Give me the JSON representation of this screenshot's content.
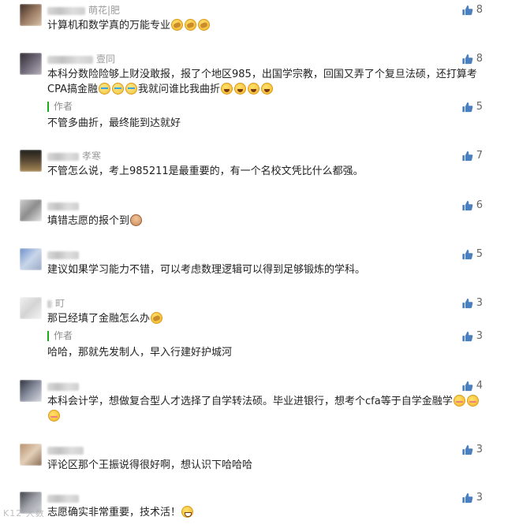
{
  "colors": {
    "accent_green": "#1aad19",
    "text": "#222222",
    "muted": "#9a9a9a"
  },
  "like_icon": "thumbs-up-icon",
  "comments": [
    {
      "name_suffix": "萌花|肥",
      "text": "计算机和数学真的万能专业",
      "emojis": [
        "facepalm",
        "facepalm",
        "facepalm"
      ],
      "likes": "8"
    },
    {
      "name_suffix": "壹同",
      "text": "本科分数险险够上财没敢报，报了个地区985，出国学宗教，回国又弄了个复旦法硕，还打算考CPA搞金融",
      "emojis_mid": [
        "tear",
        "tear",
        "tear"
      ],
      "text2": "我就问谁比我曲折",
      "emojis": [
        "laugh",
        "laugh",
        "laugh",
        "laugh"
      ],
      "likes": "8",
      "reply": {
        "tag": "作者",
        "text": "不管多曲折，最终能到达就好",
        "likes": "5"
      }
    },
    {
      "name_suffix": "孝寒",
      "text": "不管怎么说，考上985211是最重要的，有一个名校文凭比什么都强。",
      "likes": "7"
    },
    {
      "name_suffix": "",
      "text": "填错志愿的报个到",
      "emojis": [
        "person"
      ],
      "likes": "6"
    },
    {
      "name_suffix": "",
      "text": "建议如果学习能力不错，可以考虑数理逻辑可以得到足够锻炼的学科。",
      "likes": "5"
    },
    {
      "name_suffix": "町",
      "text": "那已经填了金融怎么办",
      "emojis": [
        "facepalm"
      ],
      "likes": "3",
      "reply": {
        "tag": "作者",
        "text": "哈哈，那就先发制人，早入行建好护城河",
        "likes": "3"
      }
    },
    {
      "name_suffix": "",
      "text": "本科会计学，想做复合型人才选择了自学转法硕。毕业进银行，想考个cfa等于自学金融学",
      "emojis": [
        "shy",
        "shy",
        "shy"
      ],
      "likes": "4"
    },
    {
      "name_suffix": "",
      "text": "评论区那个王振说得很好啊，想认识下哈哈哈",
      "likes": "3"
    },
    {
      "name_suffix": "",
      "text": "志愿确实非常重要，技术活！",
      "emojis": [
        "grin"
      ],
      "likes": "3"
    }
  ],
  "watermark": "K12 大数"
}
